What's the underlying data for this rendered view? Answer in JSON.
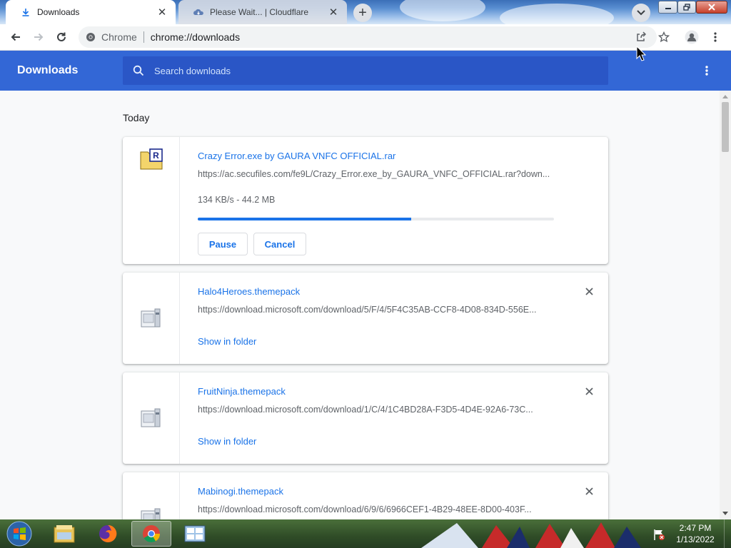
{
  "tabs": [
    {
      "title": "Downloads",
      "icon": "download-icon",
      "active": true
    },
    {
      "title": "Please Wait... | Cloudflare",
      "icon": "cloudflare-icon",
      "active": false
    }
  ],
  "toolbar": {
    "site_chip": "Chrome",
    "url": "chrome://downloads"
  },
  "downloads_header": {
    "title": "Downloads",
    "search_placeholder": "Search downloads"
  },
  "section_label": "Today",
  "downloads": [
    {
      "name": "Crazy Error.exe by GAURA VNFC OFFICIAL.rar",
      "url": "https://ac.secufiles.com/fe9L/Crazy_Error.exe_by_GAURA_VNFC_OFFICIAL.rar?down...",
      "status": "134 KB/s - 44.2 MB",
      "progress": 0.6,
      "pause_label": "Pause",
      "cancel_label": "Cancel"
    },
    {
      "name": "Halo4Heroes.themepack",
      "url": "https://download.microsoft.com/download/5/F/4/5F4C35AB-CCF8-4D08-834D-556E...",
      "action_label": "Show in folder"
    },
    {
      "name": "FruitNinja.themepack",
      "url": "https://download.microsoft.com/download/1/C/4/1C4BD28A-F3D5-4D4E-92A6-73C...",
      "action_label": "Show in folder"
    },
    {
      "name": "Mabinogi.themepack",
      "url": "https://download.microsoft.com/download/6/9/6/6966CEF1-4B29-48EE-8D00-403F..."
    }
  ],
  "taskbar": {
    "time": "2:47 PM",
    "date": "1/13/2022",
    "apps": [
      "explorer-icon",
      "firefox-icon",
      "chrome-icon",
      "control-panel-icon"
    ]
  },
  "colors": {
    "header_blue": "#3367d6",
    "link_blue": "#1a73e8",
    "progress_blue": "#1a73e8"
  }
}
